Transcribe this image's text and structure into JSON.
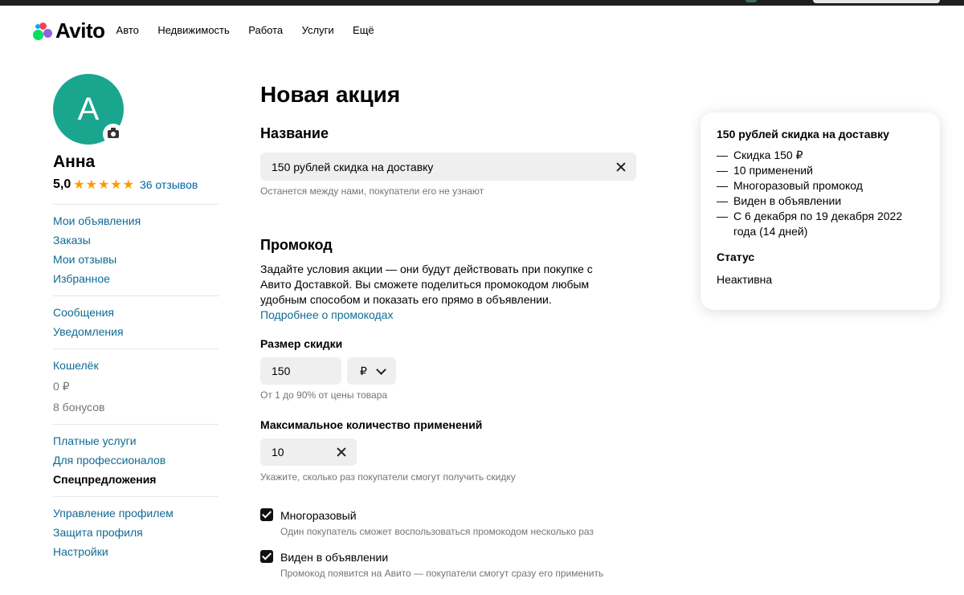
{
  "header": {
    "logo_text": "Avito",
    "nav": [
      "Авто",
      "Недвижимость",
      "Работа",
      "Услуги",
      "Ещё"
    ]
  },
  "profile": {
    "avatar_letter": "А",
    "name": "Анна",
    "rating": "5,0",
    "stars": 5,
    "reviews": "36 отзывов"
  },
  "sidebar": {
    "group1": [
      "Мои объявления",
      "Заказы",
      "Мои отзывы",
      "Избранное"
    ],
    "group2": [
      "Сообщения",
      "Уведомления"
    ],
    "wallet": {
      "label": "Кошелёк",
      "balance": "0 ₽",
      "bonuses": "8 бонусов"
    },
    "group4": [
      "Платные услуги",
      "Для профессионалов",
      "Спецпредложения"
    ],
    "group5": [
      "Управление профилем",
      "Защита профиля",
      "Настройки"
    ]
  },
  "form": {
    "title": "Новая акция",
    "name_section": "Название",
    "name_value": "150 рублей скидка на доставку",
    "name_hint": "Останется между нами, покупатели его не узнают",
    "promo_section": "Промокод",
    "promo_desc": "Задайте условия акции — они будут действовать при покупке с Авито Доставкой. Вы сможете поделиться промокодом любым удобным способом и показать его прямо в объявлении.",
    "promo_link": "Подробнее о промокодах",
    "discount_label": "Размер скидки",
    "discount_value": "150",
    "discount_currency": "₽",
    "discount_hint": "От 1 до 90% от цены товара",
    "max_uses_label": "Максимальное количество применений",
    "max_uses_value": "10",
    "max_uses_hint": "Укажите, сколько раз покупатели смогут получить скидку",
    "reusable_label": "Многоразовый",
    "reusable_hint": "Один покупатель сможет воспользоваться промокодом несколько раз",
    "visible_label": "Виден в объявлении",
    "visible_hint": "Промокод появится на Авито — покупатели смогут сразу его применить"
  },
  "summary": {
    "title": "150 рублей скидка на доставку",
    "items": [
      "Скидка 150 ₽",
      "10 применений",
      "Многоразовый промокод",
      "Виден в объявлении",
      "С 6 декабря по 19 декабря 2022 года (14 дней)"
    ],
    "status_label": "Статус",
    "status_value": "Неактивна"
  }
}
